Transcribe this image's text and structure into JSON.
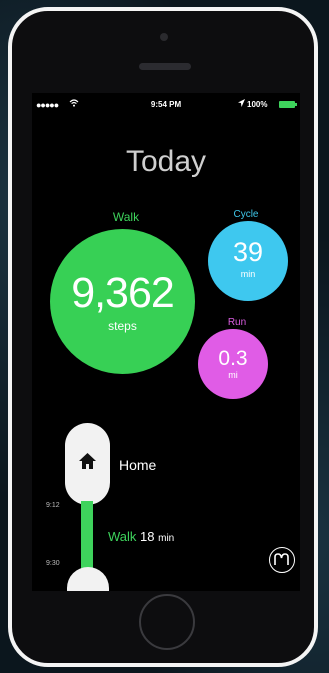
{
  "status_bar": {
    "signal": "●●●●●",
    "wifi_icon": "wifi-icon",
    "time": "9:54 PM",
    "location_icon": "location-arrow-icon",
    "battery_percent": "100%",
    "battery_color": "#3ed35c"
  },
  "header": {
    "title": "Today"
  },
  "walk": {
    "label": "Walk",
    "value": "9,362",
    "unit": "steps",
    "color": "#37d055"
  },
  "cycle": {
    "label": "Cycle",
    "value": "39",
    "unit": "min",
    "color": "#3ec8ef"
  },
  "run": {
    "label": "Run",
    "value": "0.3",
    "unit": "mi",
    "color": "#e05ce6"
  },
  "timeline": {
    "place": {
      "icon": "home-icon",
      "label": "Home"
    },
    "times": [
      "9:12",
      "9:30"
    ],
    "activity": {
      "type": "Walk",
      "duration": "18",
      "unit": "min"
    }
  },
  "app_logo": {
    "icon": "moves-logo-icon"
  }
}
